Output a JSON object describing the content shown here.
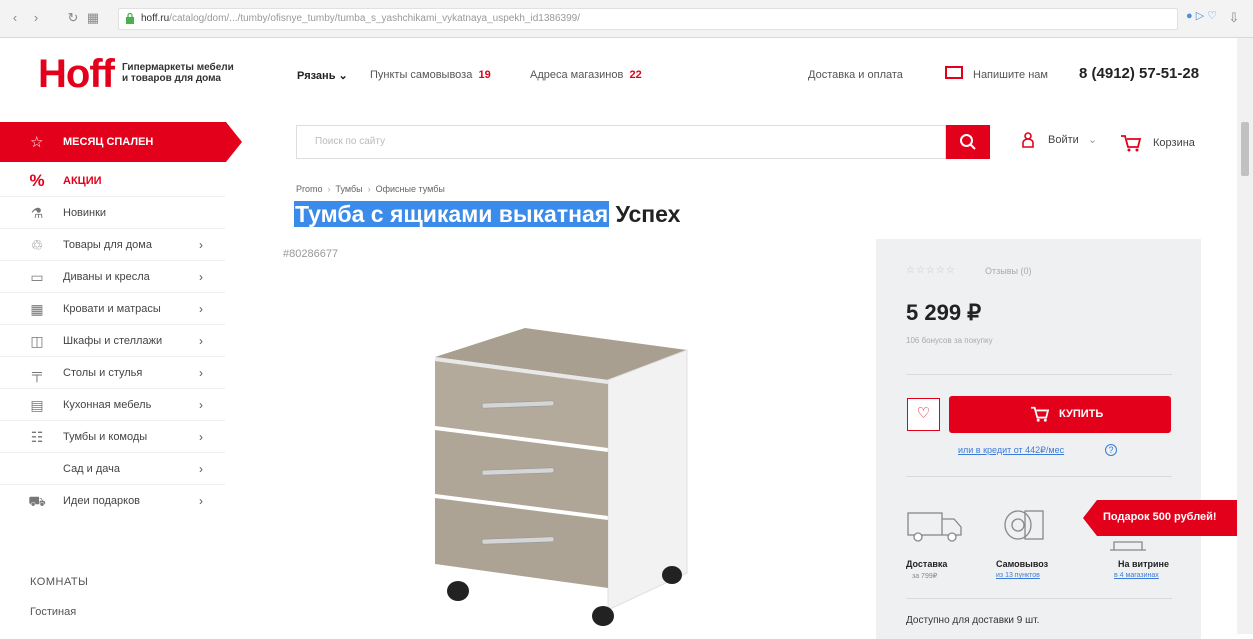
{
  "browser": {
    "url_host": "hoff.ru",
    "url_path": "/catalog/dom/.../tumby/ofisnye_tumby/tumba_s_yashchikami_vykatnaya_uspekh_id1386399/"
  },
  "header": {
    "logo": "Hoff",
    "tagline_1": "Гипермаркеты мебели",
    "tagline_2": "и товаров для дома",
    "city": "Рязань ⌄",
    "pickup_label": "Пункты самовывоза",
    "pickup_count": "19",
    "stores_label": "Адреса магазинов",
    "stores_count": "22",
    "delivery_link": "Доставка и оплата",
    "write_us": "Напишите нам",
    "phone": "8 (4912) 57-51-28"
  },
  "sidebar": {
    "promo": "МЕСЯЦ СПАЛЕН",
    "items": [
      {
        "label": "АКЦИИ",
        "icon": "%"
      },
      {
        "label": "Новинки",
        "icon": "⚗"
      },
      {
        "label": "Товары для дома",
        "icon": "♲",
        "chevron": "›"
      },
      {
        "label": "Диваны и кресла",
        "icon": "▭",
        "chevron": "›"
      },
      {
        "label": "Кровати и матрасы",
        "icon": "▦",
        "chevron": "›"
      },
      {
        "label": "Шкафы и стеллажи",
        "icon": "◫",
        "chevron": "›"
      },
      {
        "label": "Столы и стулья",
        "icon": "╤",
        "chevron": "›"
      },
      {
        "label": "Кухонная мебель",
        "icon": "▤",
        "chevron": "›"
      },
      {
        "label": "Тумбы и комоды",
        "icon": "☷",
        "chevron": "›"
      },
      {
        "label": "Сад и дача",
        "icon": "",
        "chevron": "›"
      },
      {
        "label": "Идеи подарков",
        "icon": "⛟",
        "chevron": "›"
      }
    ],
    "rooms_heading": "КОМНАТЫ",
    "room_first": "Гостиная"
  },
  "search": {
    "placeholder": "Поиск по сайту",
    "login": "Войти",
    "login_chevron": "⌄",
    "cart": "Корзина"
  },
  "breadcrumb": [
    "Promo",
    "Тумбы",
    "Офисные тумбы"
  ],
  "product": {
    "title_selected": "Тумба с ящиками выкатная",
    "title_rest": " Успех",
    "sku": "#80286677"
  },
  "buy": {
    "stars": "☆☆☆☆☆",
    "reviews": "Отзывы (0)",
    "price": "5 299 ₽",
    "bonus": "106 бонусов за покупку",
    "buy_label": "КУПИТЬ",
    "credit": "или в кредит от 442₽/мес",
    "credit_icon": "?",
    "gift": "Подарок 500 рублей!",
    "options": [
      {
        "title": "Доставка",
        "sub": "за 799₽"
      },
      {
        "title": "Самовывоз",
        "sub": "из 13 пунктов"
      },
      {
        "title": "На витрине",
        "sub": "в 4 магазинах"
      }
    ],
    "availability": "Доступно для доставки 9 шт."
  },
  "colors": {
    "brand_red": "#e3001b",
    "link_blue": "#3d7bd8",
    "selection_blue": "#3b8bea"
  }
}
